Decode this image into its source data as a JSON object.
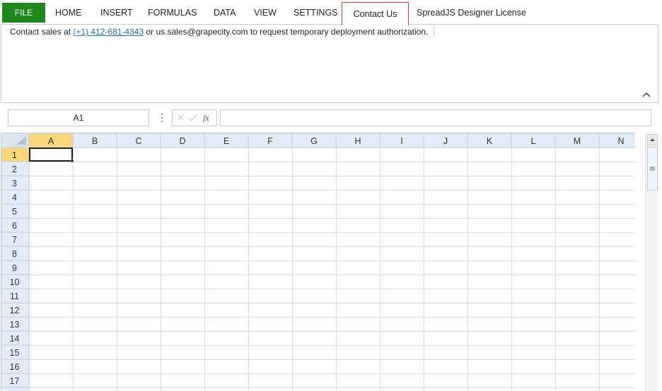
{
  "ribbon_tabs": {
    "file": "FILE",
    "home": "HOME",
    "insert": "INSERT",
    "formulas": "FORMULAS",
    "data": "DATA",
    "view": "VIEW",
    "settings": "SETTINGS",
    "contact_us": "Contact Us",
    "license": "SpreadJS Designer License"
  },
  "contact": {
    "prefix": "Contact sales at ",
    "phone": "(+1) 412-681-4343",
    "middle": " or ",
    "email": "us.sales@grapecity.com",
    "suffix": " to request temporary deployment authorization."
  },
  "formula_bar": {
    "name_box": "A1",
    "formula": "",
    "cancel_icon": "x-icon",
    "confirm_icon": "check-icon",
    "function_label": "fx"
  },
  "grid": {
    "columns": [
      "A",
      "B",
      "C",
      "D",
      "E",
      "F",
      "G",
      "H",
      "I",
      "J",
      "K",
      "L",
      "M",
      "N"
    ],
    "rows": [
      "1",
      "2",
      "3",
      "4",
      "5",
      "6",
      "7",
      "8",
      "9",
      "10",
      "11",
      "12",
      "13",
      "14",
      "15",
      "16",
      "17"
    ],
    "active_cell": "A1"
  },
  "colors": {
    "file_tab_bg": "#1e8a1e",
    "active_tab_border": "#e03c3c",
    "link": "#1a6fc4",
    "header_bg": "#e4ecf7",
    "header_active_bg": "#f9d87a",
    "gridline": "#d5dce6"
  }
}
